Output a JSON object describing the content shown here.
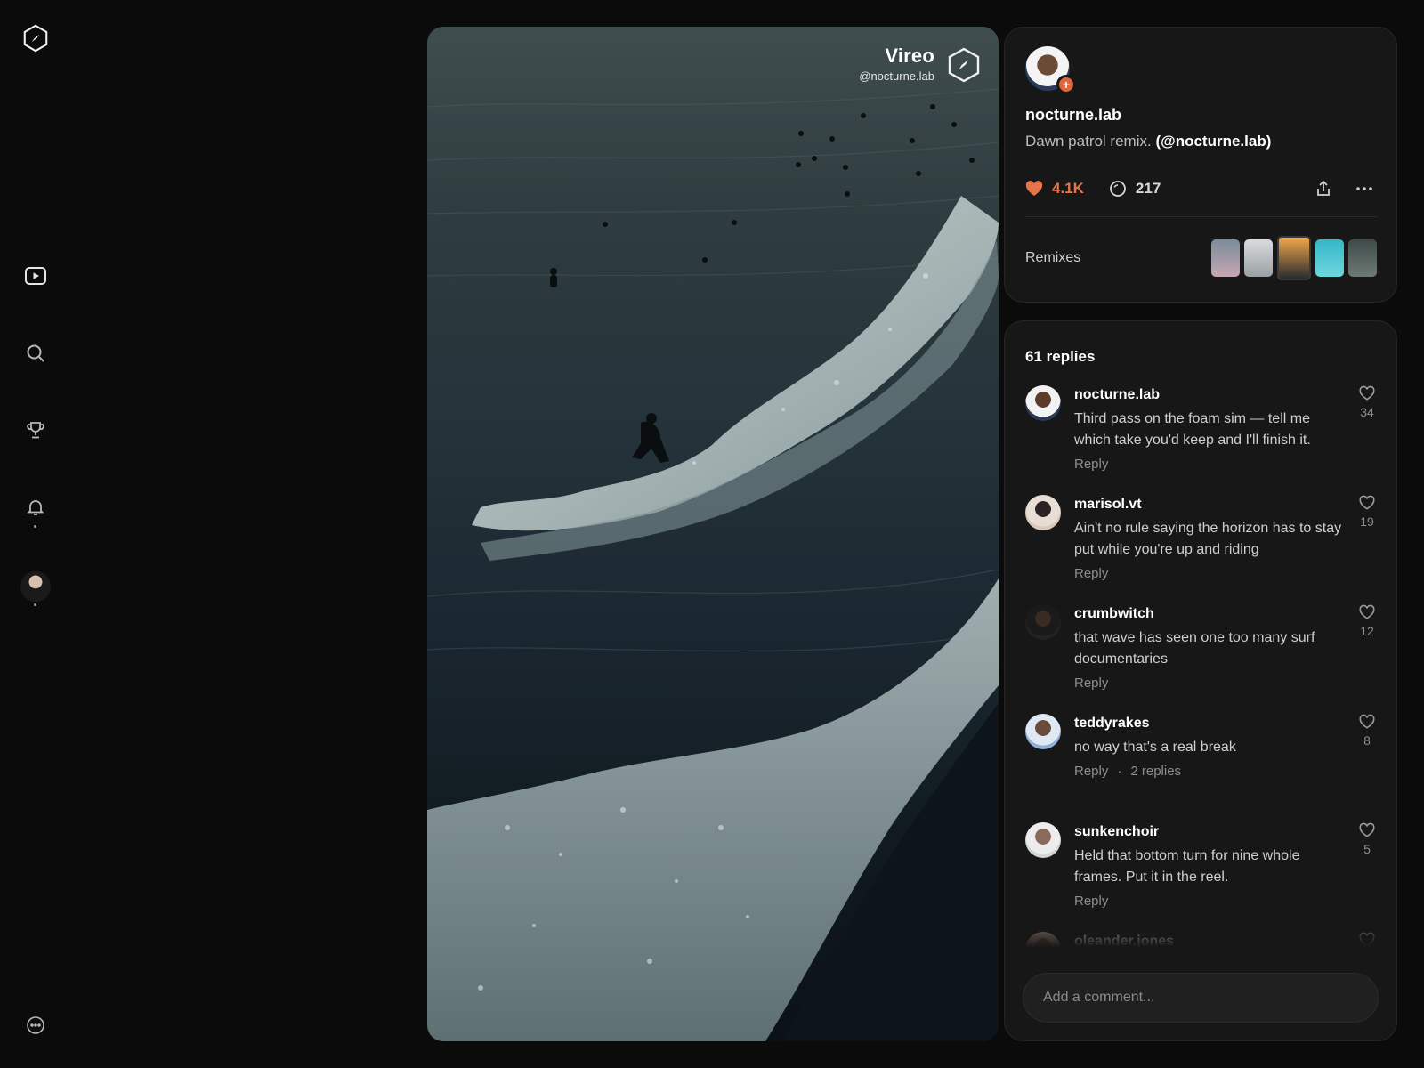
{
  "app": {
    "logo_icon": "compass-hex-icon",
    "nav": [
      {
        "icon": "play-icon"
      },
      {
        "icon": "search-icon"
      },
      {
        "icon": "trophy-icon"
      },
      {
        "icon": "bell-icon"
      }
    ],
    "more_icon": "ellipsis-circle-icon"
  },
  "video": {
    "brand_name": "Vireo",
    "handle": "@nocturne.lab"
  },
  "post": {
    "author": "nocturne.lab",
    "caption_text": "Dawn patrol remix.",
    "caption_mention": "(@nocturne.lab)",
    "likes": "4.1K",
    "comments": "217",
    "remixes_label": "Remixes",
    "remix_thumbs": [
      {
        "colors": [
          "#7a8c9a",
          "#c7a6b3"
        ]
      },
      {
        "colors": [
          "#d9dcdd",
          "#9aa0a3"
        ]
      },
      {
        "colors": [
          "#f0a64a",
          "#2a2c2e"
        ],
        "selected": true
      },
      {
        "colors": [
          "#34b6c9",
          "#6fd6de"
        ]
      },
      {
        "colors": [
          "#3d4a47",
          "#6d7b77"
        ]
      }
    ],
    "accent": "#e9744a"
  },
  "replies": {
    "count_label": "61 replies",
    "items": [
      {
        "user": "nocturne.lab",
        "text": "Third pass on the foam sim — tell me which take you'd keep and I'll finish it.",
        "reply": "Reply",
        "likes": "34",
        "avatar": [
          "#5b3b29",
          "#f2f2f2",
          "#2a3a55"
        ]
      },
      {
        "user": "marisol.vt",
        "text": "Ain't no rule saying the horizon has to stay put while you're up and riding",
        "reply": "Reply",
        "likes": "19",
        "avatar": [
          "#2a2220",
          "#e7ddd5",
          "#d9c9bc"
        ]
      },
      {
        "user": "crumbwitch",
        "text": "that wave has seen one too many surf documentaries",
        "reply": "Reply",
        "likes": "12",
        "avatar": [
          "#3a2a24",
          "#1a1a1a",
          "#222"
        ]
      },
      {
        "user": "teddyrakes",
        "text": "no way that's a real break",
        "reply": "Reply",
        "sub_replies": "2 replies",
        "likes": "8",
        "avatar": [
          "#6a4a3a",
          "#dfe8f3",
          "#8fb0d8"
        ]
      },
      {
        "user": "sunkenchoir",
        "text": "Held that bottom turn for nine whole frames. Put it in the reel.",
        "reply": "Reply",
        "likes": "5",
        "avatar": [
          "#8a6a5a",
          "#ececec",
          "#d5d5d5"
        ]
      },
      {
        "user": "oleander.jones",
        "text": "",
        "reply": "",
        "likes": "",
        "avatar": [
          "#7a5a4a",
          "#c9a894",
          "#5a3a2a"
        ]
      }
    ],
    "input_placeholder": "Add a comment..."
  }
}
